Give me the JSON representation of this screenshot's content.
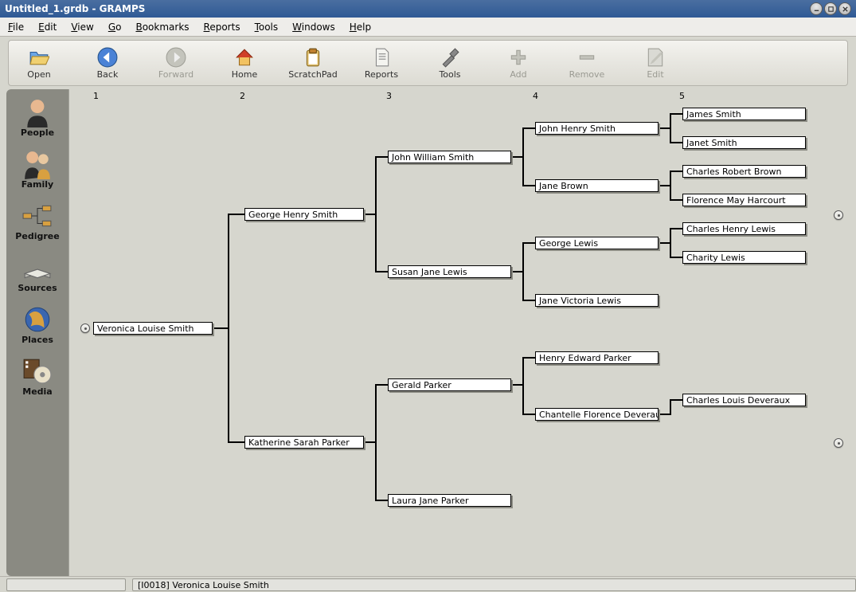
{
  "window": {
    "title": "Untitled_1.grdb - GRAMPS"
  },
  "menubar": {
    "file": "File",
    "edit": "Edit",
    "view": "View",
    "go": "Go",
    "bookmarks": "Bookmarks",
    "reports": "Reports",
    "tools": "Tools",
    "windows": "Windows",
    "help": "Help"
  },
  "toolbar": {
    "open": "Open",
    "back": "Back",
    "forward": "Forward",
    "home": "Home",
    "scratchpad": "ScratchPad",
    "reports": "Reports",
    "tools": "Tools",
    "add": "Add",
    "remove": "Remove",
    "edit": "Edit"
  },
  "sidebar": {
    "people": "People",
    "family": "Family",
    "pedigree": "Pedigree",
    "sources": "Sources",
    "places": "Places",
    "media": "Media"
  },
  "generations": {
    "g1": "1",
    "g2": "2",
    "g3": "3",
    "g4": "4",
    "g5": "5"
  },
  "tree": {
    "root": "Veronica Louise Smith",
    "g2a": "George Henry Smith",
    "g2b": "Katherine Sarah Parker",
    "g3a": "John William Smith",
    "g3b": "Susan Jane Lewis",
    "g3c": "Gerald Parker",
    "g3d": "Laura Jane Parker",
    "g4a": "John Henry Smith",
    "g4b": "Jane Brown",
    "g4c": "George Lewis",
    "g4d": "Jane Victoria Lewis",
    "g4e": "Henry Edward Parker",
    "g4f": "Chantelle Florence Deveraux",
    "g5a": "James Smith",
    "g5b": "Janet Smith",
    "g5c": "Charles Robert Brown",
    "g5d": "Florence May Harcourt",
    "g5e": "Charles Henry Lewis",
    "g5f": "Charity Lewis",
    "g5g": "Charles Louis Deveraux"
  },
  "status": {
    "text": "[I0018] Veronica Louise Smith"
  }
}
